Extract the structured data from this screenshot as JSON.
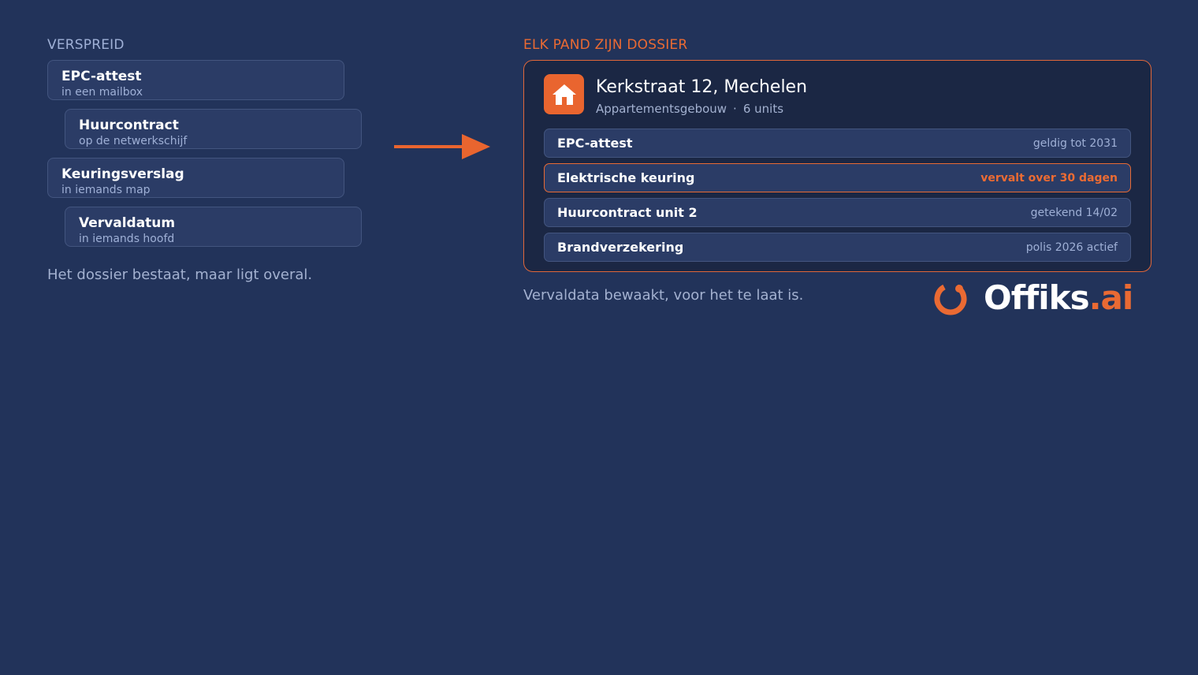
{
  "left": {
    "heading": "VERSPREID",
    "items": [
      {
        "title": "EPC-attest",
        "subtitle": "in een mailbox"
      },
      {
        "title": "Huurcontract",
        "subtitle": "op de netwerkschijf"
      },
      {
        "title": "Keuringsverslag",
        "subtitle": "in iemands map"
      },
      {
        "title": "Vervaldatum",
        "subtitle": "in iemands hoofd"
      }
    ],
    "caption": "Het dossier bestaat, maar ligt overal."
  },
  "right": {
    "heading": "ELK PAND ZIJN DOSSIER",
    "property": {
      "icon": "house-icon",
      "title": "Kerkstraat 12, Mechelen",
      "type": "Appartementsgebouw",
      "separator": "·",
      "units": "6 units"
    },
    "documents": [
      {
        "name": "EPC-attest",
        "status": "geldig tot 2031",
        "highlight": false
      },
      {
        "name": "Elektrische keuring",
        "status": "vervalt over 30 dagen",
        "highlight": true
      },
      {
        "name": "Huurcontract unit 2",
        "status": "getekend 14/02",
        "highlight": false
      },
      {
        "name": "Brandverzekering",
        "status": "polis 2026 actief",
        "highlight": false
      }
    ],
    "caption": "Vervaldata bewaakt, voor het te laat is."
  },
  "brand": {
    "name": "Offiks",
    "suffix": ".ai",
    "logo_icon": "ring-logo-icon"
  },
  "colors": {
    "background": "#22335a",
    "accent": "#ea6a33",
    "card": "#2b3c66",
    "muted_text": "#9fb0d6"
  }
}
